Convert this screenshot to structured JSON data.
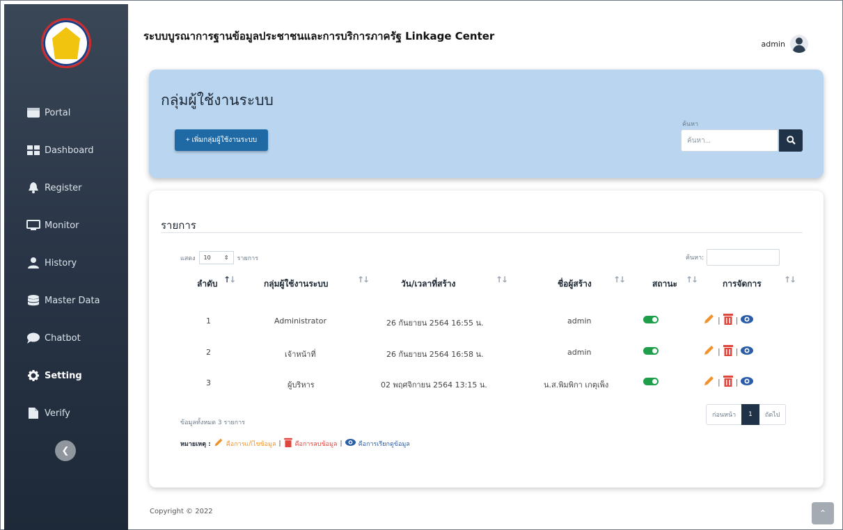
{
  "app_title": "ระบบบูรณาการฐานข้อมูลประชาชนและการบริการภาครัฐ Linkage Center",
  "user": {
    "name": "admin"
  },
  "sidebar": {
    "items": [
      {
        "label": "Portal",
        "icon": "window-icon"
      },
      {
        "label": "Dashboard",
        "icon": "grid-icon"
      },
      {
        "label": "Register",
        "icon": "bell-icon"
      },
      {
        "label": "Monitor",
        "icon": "monitor-icon"
      },
      {
        "label": "History",
        "icon": "user-icon"
      },
      {
        "label": "Master Data",
        "icon": "database-icon"
      },
      {
        "label": "Chatbot",
        "icon": "chat-icon"
      },
      {
        "label": "Setting",
        "icon": "gear-icon",
        "active": true
      },
      {
        "label": "Verify",
        "icon": "file-icon"
      }
    ]
  },
  "top_card": {
    "title": "กลุ่มผู้ใช้งานระบบ",
    "add_button": "+ เพิ่มกลุ่มผู้ใช้งานระบบ",
    "search_label": "ค้นหา",
    "search_placeholder": "ค้นหา..."
  },
  "list": {
    "title": "รายการ",
    "length_prefix": "แสดง",
    "length_value": "10",
    "length_suffix": "รายการ",
    "filter_label": "ค้นหา:",
    "columns": [
      "ลำดับ",
      "กลุ่มผู้ใช้งานระบบ",
      "วัน/เวลาที่สร้าง",
      "ชื่อผู้สร้าง",
      "สถานะ",
      "การจัดการ"
    ],
    "rows": [
      {
        "no": "1",
        "group": "Administrator",
        "created": "26 กันยายน 2564 16:55 น.",
        "creator": "admin",
        "status": true
      },
      {
        "no": "2",
        "group": "เจ้าหน้าที่",
        "created": "26 กันยายน 2564 16:58 น.",
        "creator": "admin",
        "status": true
      },
      {
        "no": "3",
        "group": "ผู้บริหาร",
        "created": "02 พฤศจิกายน 2564 13:15 น.",
        "creator": "น.ส.พิมพิกา เกตุเพ็ง",
        "status": true
      }
    ],
    "info": "ข้อมูลทั้งหมด 3 รายการ",
    "pager": {
      "prev": "ก่อนหน้า",
      "current": "1",
      "next": "ถัดไป"
    },
    "note": {
      "key": "หมายเหตุ :",
      "edit": "คือการแก้ไขข้อมูล",
      "delete": "คือการลบข้อมูล",
      "view": "คือการเรียกดูข้อมูล",
      "sep": "|"
    }
  },
  "footer": {
    "copyright": "Copyright © 2022"
  },
  "colors": {
    "sidebar": "#2a3647",
    "accent_blue": "#1f6aa5",
    "toggle_on": "#1e9e4a",
    "edit": "#f0912a",
    "delete": "#e0443a",
    "view": "#2a5ca8"
  }
}
